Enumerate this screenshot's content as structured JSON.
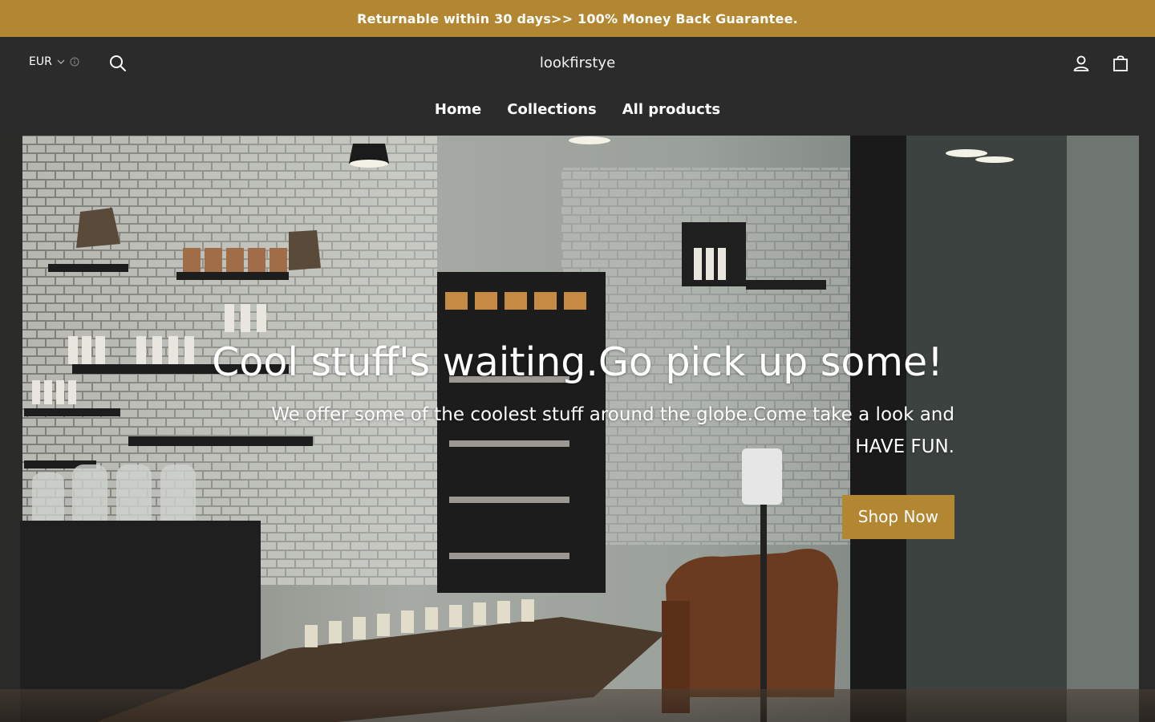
{
  "colors": {
    "accent": "#b38732",
    "header_bg": "#2b2b2b",
    "text": "#ffffff"
  },
  "announcement": {
    "text": "Returnable within 30 days>> 100% Money Back Guarantee."
  },
  "header": {
    "currency": "EUR",
    "currency_icon": "chevron-down-icon",
    "info_icon": "info-icon",
    "search_icon": "search-icon",
    "brand": "lookfirstye",
    "account_icon": "user-icon",
    "cart_icon": "shopping-bag-icon"
  },
  "nav": {
    "items": [
      {
        "label": "Home"
      },
      {
        "label": "Collections"
      },
      {
        "label": "All products"
      }
    ]
  },
  "hero": {
    "title": "Cool stuff's waiting.Go pick up some!",
    "subtitle": "We offer some of the coolest stuff around the globe.Come take a look and HAVE FUN.",
    "cta_label": "Shop Now"
  }
}
